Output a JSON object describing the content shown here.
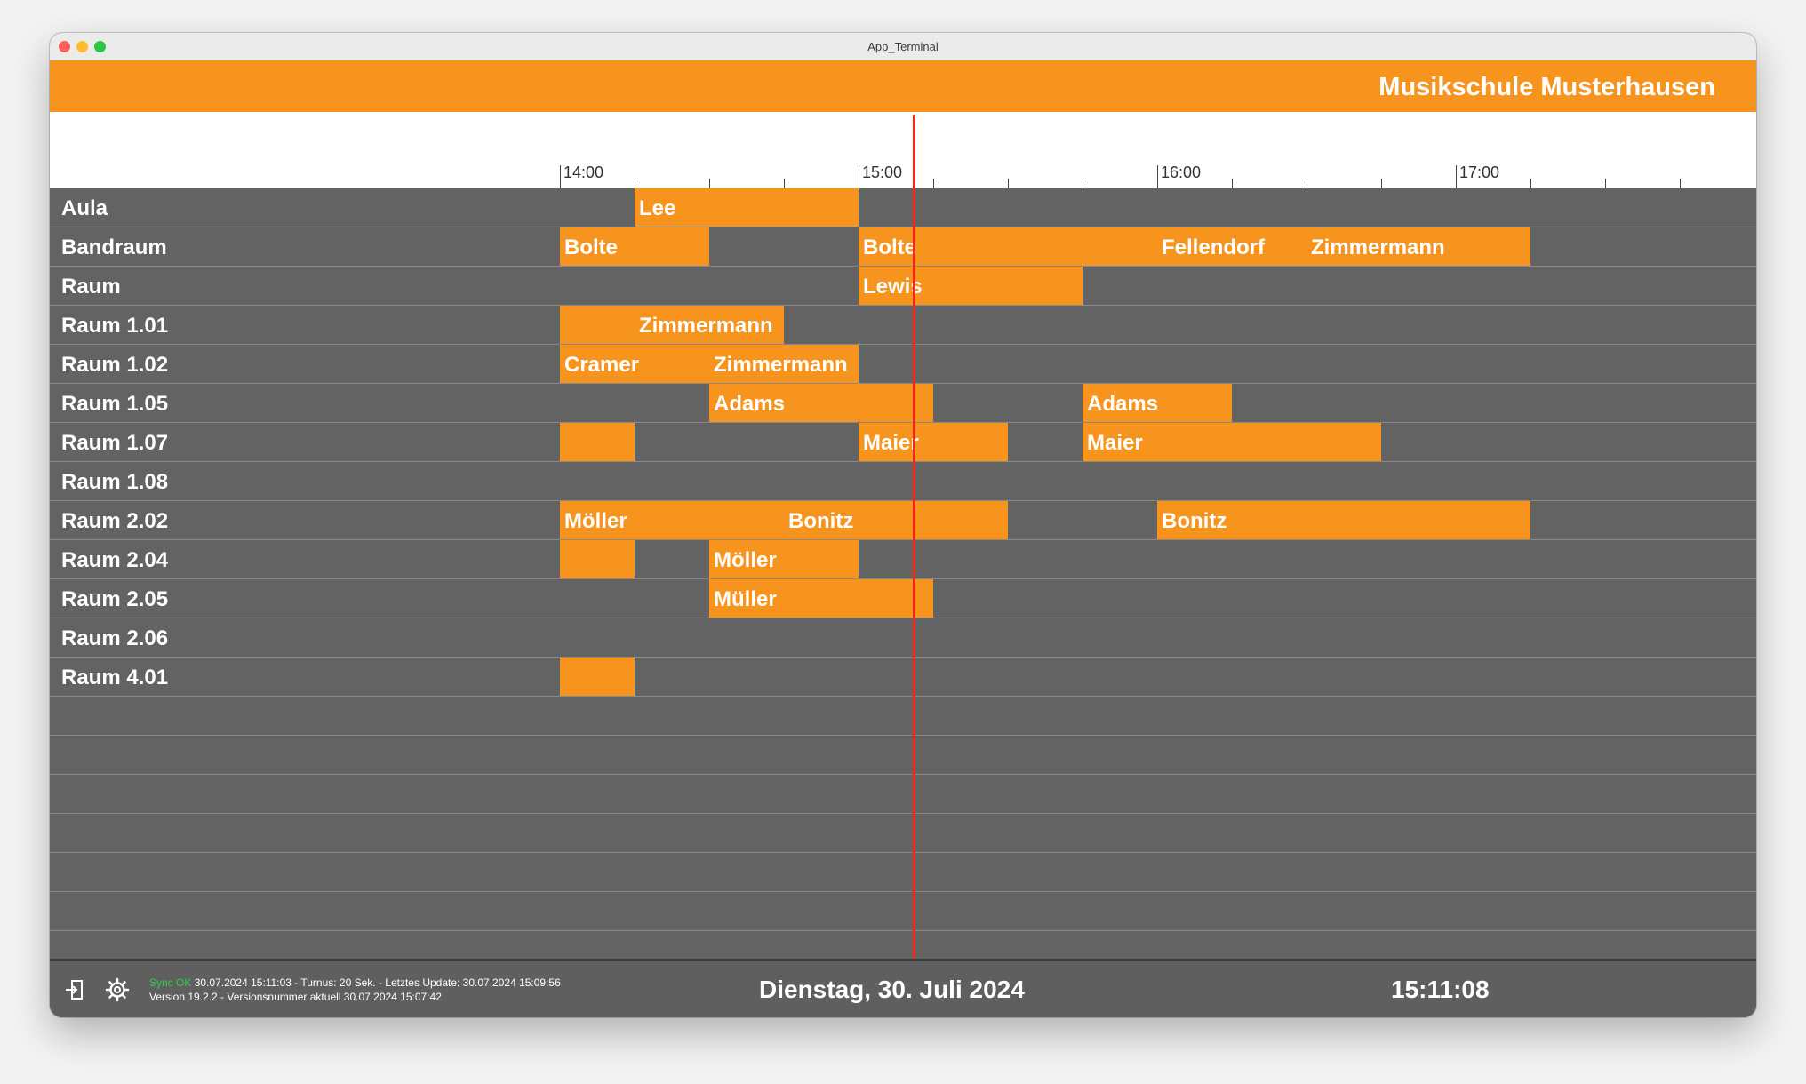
{
  "window": {
    "title": "App_Terminal"
  },
  "header": {
    "title": "Musikschule Musterhausen"
  },
  "timeline": {
    "labels": [
      "14:00",
      "15:00",
      "16:00",
      "17:00"
    ]
  },
  "rooms": [
    "Aula",
    "Bandraum",
    "Raum",
    "Raum 1.01",
    "Raum 1.02",
    "Raum 1.05",
    "Raum 1.07",
    "Raum 1.08",
    "Raum 2.02",
    "Raum 2.04",
    "Raum 2.05",
    "Raum 2.06",
    "Raum 4.01"
  ],
  "bookings": [
    {
      "room": 0,
      "start": "14:15",
      "end": "15:00",
      "label": "Lee"
    },
    {
      "room": 1,
      "start": "14:00",
      "end": "14:30",
      "label": "Bolte"
    },
    {
      "room": 1,
      "start": "15:00",
      "end": "16:00",
      "label": "Bolte"
    },
    {
      "room": 1,
      "start": "16:00",
      "end": "16:30",
      "label": "Fellendorf"
    },
    {
      "room": 1,
      "start": "16:30",
      "end": "17:15",
      "label": "Zimmermann"
    },
    {
      "room": 2,
      "start": "15:00",
      "end": "15:45",
      "label": "Lewis"
    },
    {
      "room": 3,
      "start": "14:00",
      "end": "14:15",
      "label": ""
    },
    {
      "room": 3,
      "start": "14:15",
      "end": "14:45",
      "label": "Zimmermann"
    },
    {
      "room": 4,
      "start": "14:00",
      "end": "14:30",
      "label": "Cramer"
    },
    {
      "room": 4,
      "start": "14:30",
      "end": "15:00",
      "label": "Zimmermann"
    },
    {
      "room": 5,
      "start": "14:30",
      "end": "15:15",
      "label": "Adams"
    },
    {
      "room": 5,
      "start": "15:45",
      "end": "16:15",
      "label": "Adams"
    },
    {
      "room": 6,
      "start": "14:00",
      "end": "14:15",
      "label": ""
    },
    {
      "room": 6,
      "start": "15:00",
      "end": "15:30",
      "label": "Maier"
    },
    {
      "room": 6,
      "start": "15:45",
      "end": "16:45",
      "label": "Maier"
    },
    {
      "room": 8,
      "start": "14:00",
      "end": "14:45",
      "label": "Möller"
    },
    {
      "room": 8,
      "start": "14:45",
      "end": "15:30",
      "label": "Bonitz"
    },
    {
      "room": 8,
      "start": "16:00",
      "end": "17:15",
      "label": "Bonitz"
    },
    {
      "room": 9,
      "start": "14:00",
      "end": "14:15",
      "label": ""
    },
    {
      "room": 9,
      "start": "14:30",
      "end": "15:00",
      "label": "Möller"
    },
    {
      "room": 10,
      "start": "14:30",
      "end": "15:15",
      "label": "Müller"
    },
    {
      "room": 12,
      "start": "14:00",
      "end": "14:15",
      "label": ""
    }
  ],
  "current_time": "15:11:08",
  "footer": {
    "sync_status": "Sync OK",
    "sync_details": "30.07.2024 15:11:03 - Turnus: 20 Sek. - Letztes Update: 30.07.2024 15:09:56",
    "version": "Version 19.2.2 - Versionsnummer aktuell 30.07.2024 15:07:42",
    "date": "Dienstag, 30. Juli 2024",
    "clock": "15:11:08"
  },
  "icons": {
    "exit": "exit-door-icon",
    "settings": "gear-icon"
  },
  "colors": {
    "accent": "#f7941e",
    "grid": "#636363",
    "now_line": "#f3281a",
    "sync_ok": "#2bd24a"
  }
}
